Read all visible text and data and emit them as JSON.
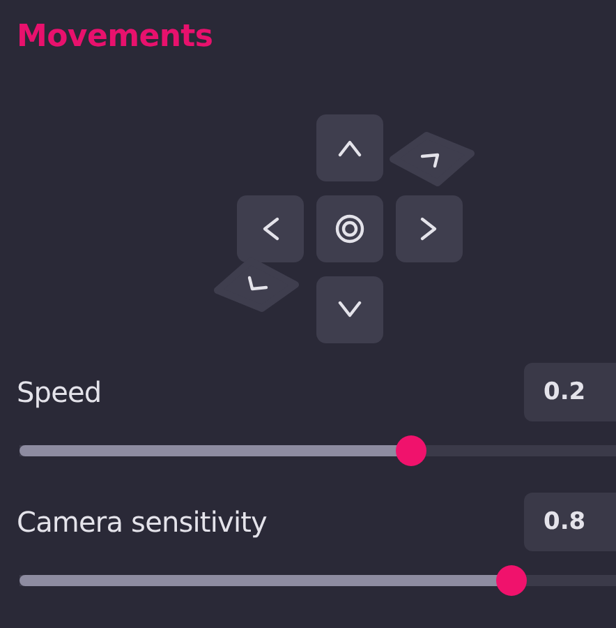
{
  "title": "Movements",
  "sliders": [
    {
      "label": "Speed",
      "value": "0.2",
      "level": 0.654
    },
    {
      "label": "Camera sensitivity",
      "value": "0.8",
      "level": 0.82
    }
  ]
}
